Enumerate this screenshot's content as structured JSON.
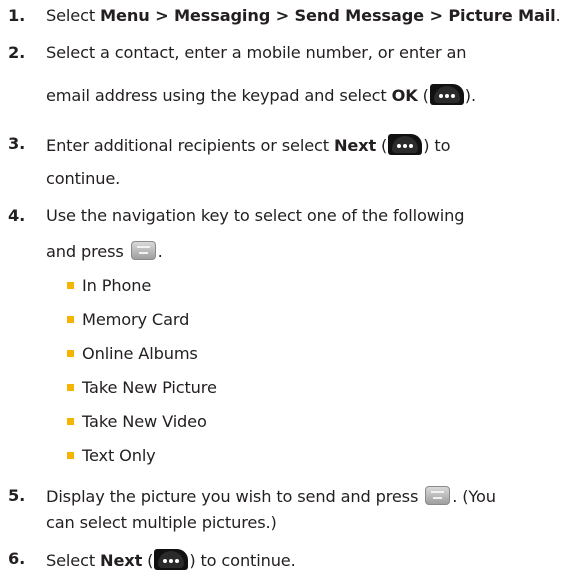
{
  "steps": {
    "s1": {
      "num": "1.",
      "l1": {
        "a": "Select ",
        "b": "Menu > Messaging > Send Message > Picture Mail",
        "c": "."
      }
    },
    "s2": {
      "num": "2.",
      "l1": "Select a contact, enter a mobile number, or enter an",
      "l2": {
        "a": "email address using the keypad and select ",
        "b": "OK",
        "c": " (",
        "d": ")."
      }
    },
    "s3": {
      "num": "3.",
      "l1": {
        "a": "Enter additional recipients or select ",
        "b": "Next",
        "c": " (",
        "d": ") to"
      },
      "l2": "continue."
    },
    "s4": {
      "num": "4.",
      "l1": "Use the navigation key to select one of the following",
      "l2": {
        "a": "and press ",
        "b": "."
      }
    },
    "options": [
      "In Phone",
      "Memory Card",
      "Online Albums",
      "Take New Picture",
      "Take New Video",
      "Text Only"
    ],
    "s5": {
      "num": "5.",
      "l1": {
        "a": "Display the picture you wish to send and press ",
        "b": ". (You"
      },
      "l2": "can select multiple pictures.)"
    },
    "s6": {
      "num": "6.",
      "l1": {
        "a": "Select ",
        "b": "Next",
        "c": " (",
        "d": ") to continue."
      }
    }
  },
  "icons": {
    "softkey": "right-softkey-icon",
    "menu_ok": "menu-ok-key-icon"
  },
  "colors": {
    "text": "#231f20",
    "bullet": "#f5b400"
  }
}
